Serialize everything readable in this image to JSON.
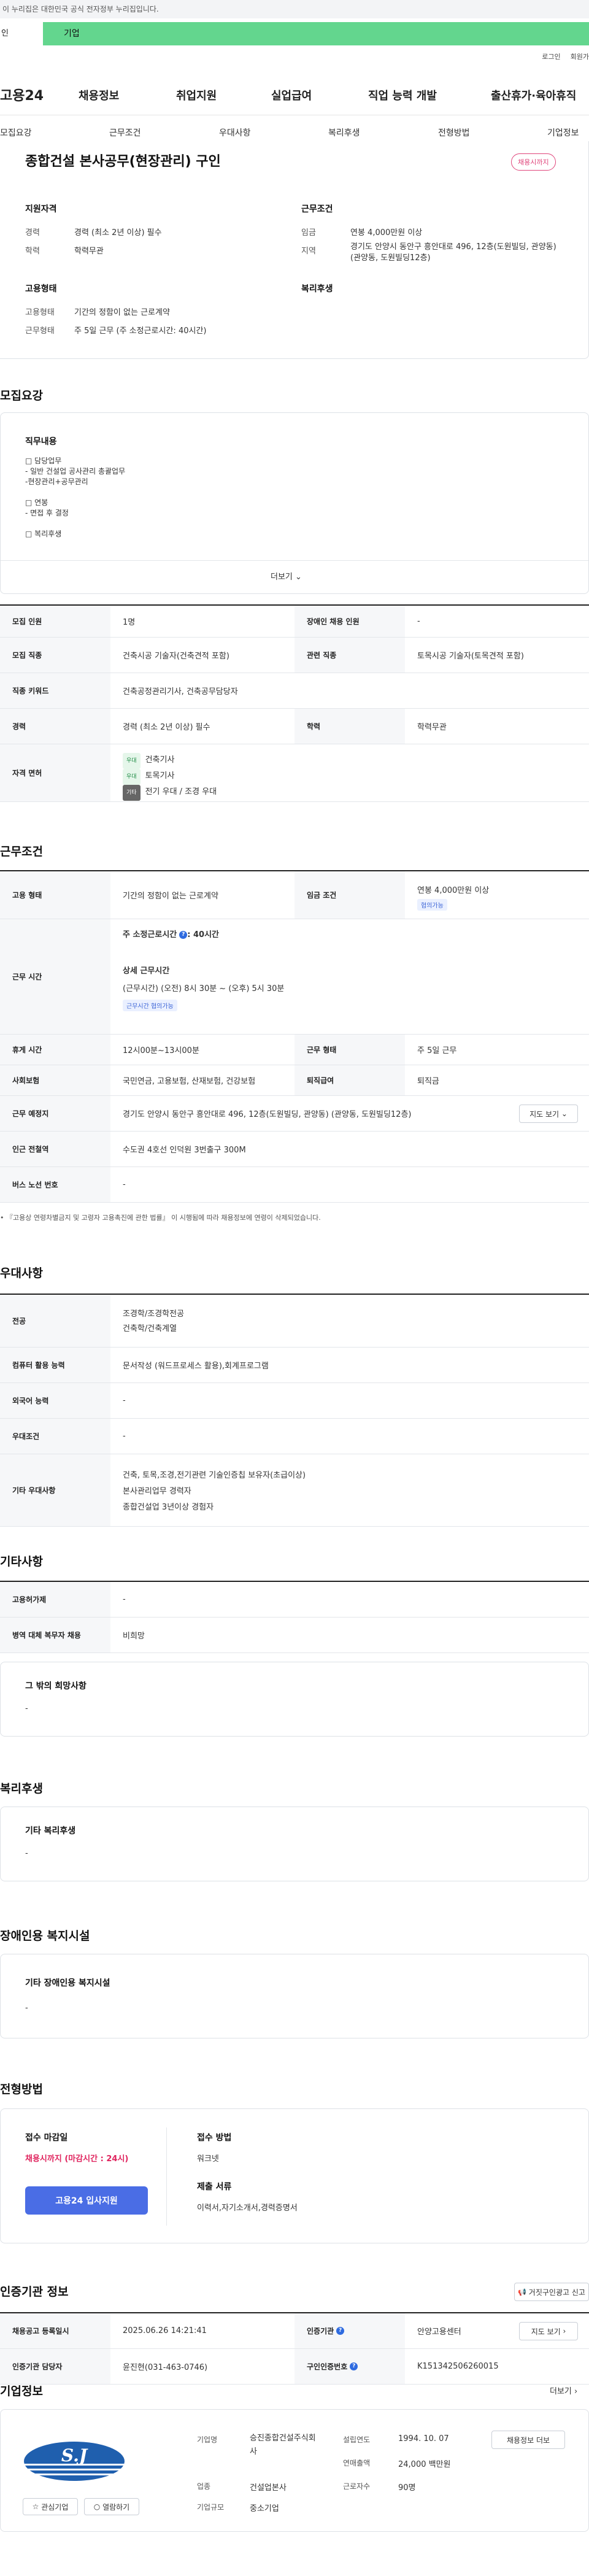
{
  "banner": {
    "text": "이 누리집은 대한민국 공식 전자정부 누리집입니다."
  },
  "usertabs": {
    "personal": "인",
    "company": "기업"
  },
  "util": {
    "login": "로그인",
    "join": "회원가"
  },
  "gnb": {
    "logo": "고용24",
    "items": [
      "채용정보",
      "취업지원",
      "실업급여",
      "직업 능력 개발",
      "출산휴가·육아휴직"
    ]
  },
  "snb": {
    "items": [
      "모집요강",
      "근무조건",
      "우대사항",
      "복리후생",
      "전형방법",
      "기업정보"
    ]
  },
  "summary": {
    "title": "종합건설 본사공무(현장관리) 구인",
    "status_badge": "채용시까지",
    "qual_heading": "지원자격",
    "qual": [
      {
        "label": "경력",
        "value": "경력 (최소 2년 이상) 필수"
      },
      {
        "label": "학력",
        "value": "학력무관"
      }
    ],
    "cond_heading": "근무조건",
    "cond": [
      {
        "label": "임금",
        "value": "연봉 4,000만원 이상"
      },
      {
        "label": "지역",
        "value": "경기도 안양시 동안구 흥안대로 496, 12층(도원빌딩, 관양동) (관양동, 도원빌딩12층)"
      }
    ],
    "emp_heading": "고용형태",
    "emp": [
      {
        "label": "고용형태",
        "value": "기간의 정함이 없는 근로계약"
      },
      {
        "label": "근무형태",
        "value": "주 5일 근무 (주 소정근로시간: 40시간)"
      }
    ],
    "welfare_heading": "복리후생"
  },
  "recruit": {
    "heading": "모집요강",
    "duty_title": "직무내용",
    "duty_lines": [
      "□ 담당업무",
      "- 일반 건설업 공사관리 총괄업무",
      "-현장관리+공무관리",
      "",
      "□ 연봉",
      "- 면접 후 결정",
      "",
      "□ 복리후생"
    ],
    "more": "더보기",
    "table": [
      {
        "k1": "모집 인원",
        "v1": "1명",
        "k2": "장애인 채용 인원",
        "v2": "-"
      },
      {
        "k1": "모집 직종",
        "v1": "건축시공 기술자(건축견적 포함)",
        "k2": "관련 직종",
        "v2": "토목시공 기술자(토목견적 포함)"
      },
      {
        "k1": "직종 키워드",
        "v1": "건축공정관리기사, 건축공무담당자",
        "k2": "",
        "v2": ""
      },
      {
        "k1": "경력",
        "v1": "경력 (최소 2년 이상) 필수",
        "k2": "학력",
        "v2": "학력무관"
      }
    ],
    "license_label": "자격 면허",
    "licenses": [
      {
        "tag": "우대",
        "name": "건축기사"
      },
      {
        "tag": "우대",
        "name": "토목기사"
      },
      {
        "tag": "기타",
        "name": "전기 우대 / 조경 우대"
      }
    ]
  },
  "work": {
    "heading": "근무조건",
    "emp_label": "고용 형태",
    "emp_value": "기간의 정함이 없는 근로계약",
    "wage_label": "임금 조건",
    "wage_value": "연봉 4,000만원 이상",
    "wage_tag": "협의가능",
    "time_label": "근무 시간",
    "weekly": "주 소정근로시간",
    "weekly_value": ": 40시간",
    "detail_title": "상세 근무시간",
    "detail_value": "(근무시간) (오전) 8시 30분 ~ (오후) 5시 30분",
    "detail_tag": "근무시간 협의가능",
    "break_label": "휴게 시간",
    "break_value": "12시00분~13시00분",
    "worktype_label": "근무 형태",
    "worktype_value": "주 5일 근무",
    "ins_label": "사회보험",
    "ins_value": "국민연금, 고용보험, 산재보험, 건강보험",
    "sev_label": "퇴직급여",
    "sev_value": "퇴직금",
    "place_label": "근무 예정지",
    "place_value": "경기도 안양시 동안구 흥안대로 496, 12층(도원빌딩, 관양동) (관양동, 도원빌딩12층)",
    "map_btn": "지도 보기",
    "subway_label": "인근 전철역",
    "subway_value": "수도권 4호선 인덕원 3번출구 300M",
    "bus_label": "버스 노선 번호",
    "bus_value": "-",
    "footnote": "• 『고용상 연령차별금지 및 고령자 고용촉진에 관한 법률』 이 시행됨에 따라 채용정보에 연령이 삭제되었습니다."
  },
  "pref": {
    "heading": "우대사항",
    "rows": [
      {
        "k": "전공",
        "lines": [
          "조경학/조경학전공",
          "건축학/건축계열"
        ]
      },
      {
        "k": "컴퓨터 활용 능력",
        "lines": [
          "문서작성 (워드프로세스 활용),회계프로그램"
        ]
      },
      {
        "k": "외국어 능력",
        "lines": [
          "-"
        ]
      },
      {
        "k": "우대조건",
        "lines": [
          "-"
        ]
      },
      {
        "k": "기타 우대사항",
        "lines": [
          "건축, 토목,조경,전기관련 기술인증칩 보유자(초급이상)",
          "본사관리업무 경력자",
          "종합건설업  3년이상 경험자"
        ]
      }
    ]
  },
  "etc": {
    "heading": "기타사항",
    "rows": [
      {
        "k": "고용허가제",
        "v": "-"
      },
      {
        "k": "병역 대체 복무자 채용",
        "v": "비희망"
      }
    ],
    "other_title": "그 밖의 희망사항",
    "other_value": "-"
  },
  "benefit": {
    "heading": "복리후생",
    "title": "기타 복리후생",
    "value": "-"
  },
  "disability": {
    "heading": "장애인용 복지시설",
    "title": "기타 장애인용 복지시설",
    "value": "-"
  },
  "process": {
    "heading": "전형방법",
    "deadline_title": "접수 마감일",
    "deadline_value": "채용시까지 (마감시간 : 24시)",
    "apply_btn": "고용24 입사지원",
    "method_title": "접수 방법",
    "method_value": "워크넷",
    "docs_title": "제출 서류",
    "docs_value": "이력서,자기소개서,경력증명서"
  },
  "cert": {
    "heading": "인증기관 정보",
    "report_btn": "거짓구인광고 신고",
    "rows": [
      {
        "k1": "채용공고 등록일시",
        "v1": "2025.06.26 14:21:41",
        "k2": "인증기관",
        "v2": "안양고용센터",
        "btn": "지도 보기"
      },
      {
        "k1": "인증기관 담당자",
        "v1": "윤진현(031-463-0746)",
        "k2": "구인인증번호",
        "v2": "K151342506260015",
        "btn": ""
      }
    ]
  },
  "company": {
    "heading": "기업정보",
    "more": "더보기",
    "logo_text": "S.J",
    "fav_btn": "관심기업",
    "follow_btn": "열람하기",
    "name_label": "기업명",
    "name_value": "승진종합건설주식회사",
    "industry_label": "업종",
    "industry_value": "건설업본사",
    "scale_label": "기업규모",
    "scale_value": "중소기업",
    "founded_label": "설립연도",
    "founded_value": "1994. 10. 07",
    "sales_label": "연매출액",
    "sales_value": "24,000 백만원",
    "employees_label": "근로자수",
    "employees_value": "90명",
    "jobs_btn": "채용정보 더보"
  }
}
